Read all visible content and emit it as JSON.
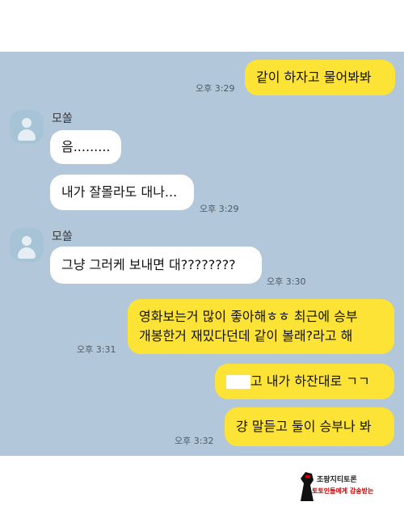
{
  "conversation": {
    "partner_name": "모쏠",
    "messages": [
      {
        "from": "me",
        "text": "같이 하자고 물어봐봐",
        "time": "오후 3:29"
      },
      {
        "from": "partner",
        "text": "음.........",
        "time": ""
      },
      {
        "from": "partner",
        "text": "내가 잘몰라도 대나...",
        "time": "오후 3:29"
      },
      {
        "from": "partner",
        "text": "그냥 그러케 보내면 대????????",
        "time": "오후 3:30"
      },
      {
        "from": "me",
        "lines": [
          "영화보는거 많이 좋아해ㅎㅎ 최근에 승부",
          "개봉한거 재밌다던데 같이 볼래?라고 해"
        ],
        "time": "오후 3:31"
      },
      {
        "from": "me",
        "text_hidden_prefix": "",
        "text": "고 내가 하잔대로 ㄱㄱ",
        "time": ""
      },
      {
        "from": "me",
        "text": "걍 말듣고 둘이 승부나 봐",
        "time": "오후 3:32"
      }
    ]
  },
  "watermark": {
    "line1": "조팡지티토론",
    "line2": "토토인들에게 감송받는"
  },
  "colors": {
    "chat_bg": "#b2c7d9",
    "my_bubble": "#fde336",
    "partner_bubble": "#ffffff"
  }
}
